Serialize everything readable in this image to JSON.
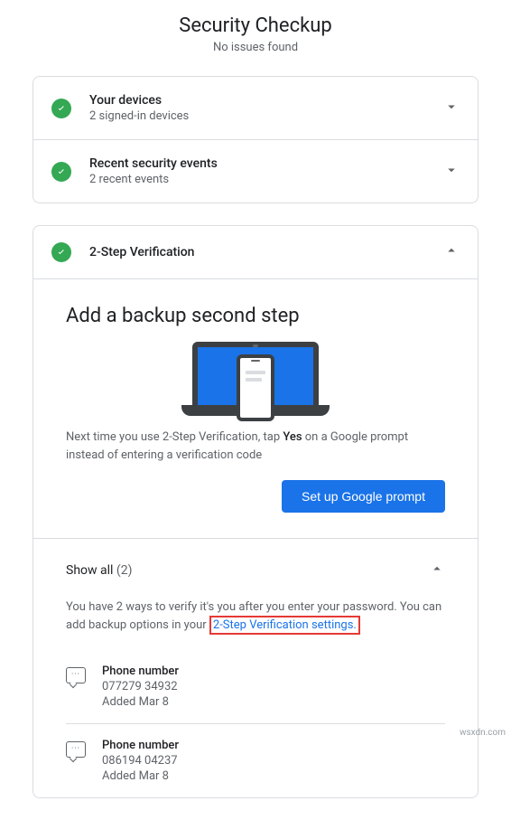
{
  "header": {
    "title": "Security Checkup",
    "subtitle": "No issues found"
  },
  "sections": {
    "devices": {
      "title": "Your devices",
      "subtitle": "2 signed-in devices"
    },
    "events": {
      "title": "Recent security events",
      "subtitle": "2 recent events"
    },
    "twostep": {
      "title": "2-Step Verification"
    }
  },
  "backup": {
    "heading": "Add a backup second step",
    "desc_pre": "Next time you use 2-Step Verification, tap ",
    "desc_bold": "Yes",
    "desc_post": " on a Google prompt instead of entering a verification code",
    "button": "Set up Google prompt"
  },
  "showall": {
    "label": "Show all ",
    "count": "(2)",
    "desc_pre": "You have 2 ways to verify it's you after you enter your password. You can add backup options in your ",
    "link": "2-Step Verification settings."
  },
  "entries": [
    {
      "title": "Phone number",
      "value": "077279 34932",
      "added": "Added Mar 8"
    },
    {
      "title": "Phone number",
      "value": "086194 04237",
      "added": "Added Mar 8"
    }
  ],
  "watermark": "wsxdn.com"
}
